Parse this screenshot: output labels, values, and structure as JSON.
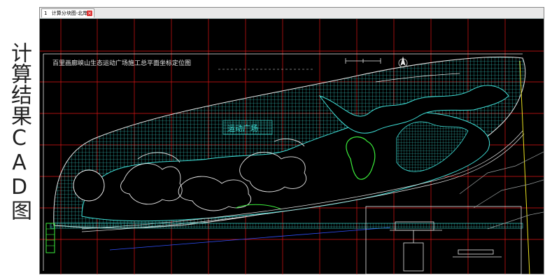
{
  "side_caption": "计算结果CAD图",
  "tab": {
    "number": "1",
    "label": "计算分块图-北岸线",
    "close_glyph": "×"
  },
  "drawing": {
    "title": "百里画廊峡山生态运动广场施工总平面坐标定位图",
    "plaza_label": "运动广场",
    "colors": {
      "background": "#000000",
      "grid": "#e01515",
      "mesh": "#3fe0d8",
      "outline": "#e8e8e8",
      "green": "#3cf03c",
      "yellow": "#e8e020",
      "blue": "#3050ff"
    }
  }
}
